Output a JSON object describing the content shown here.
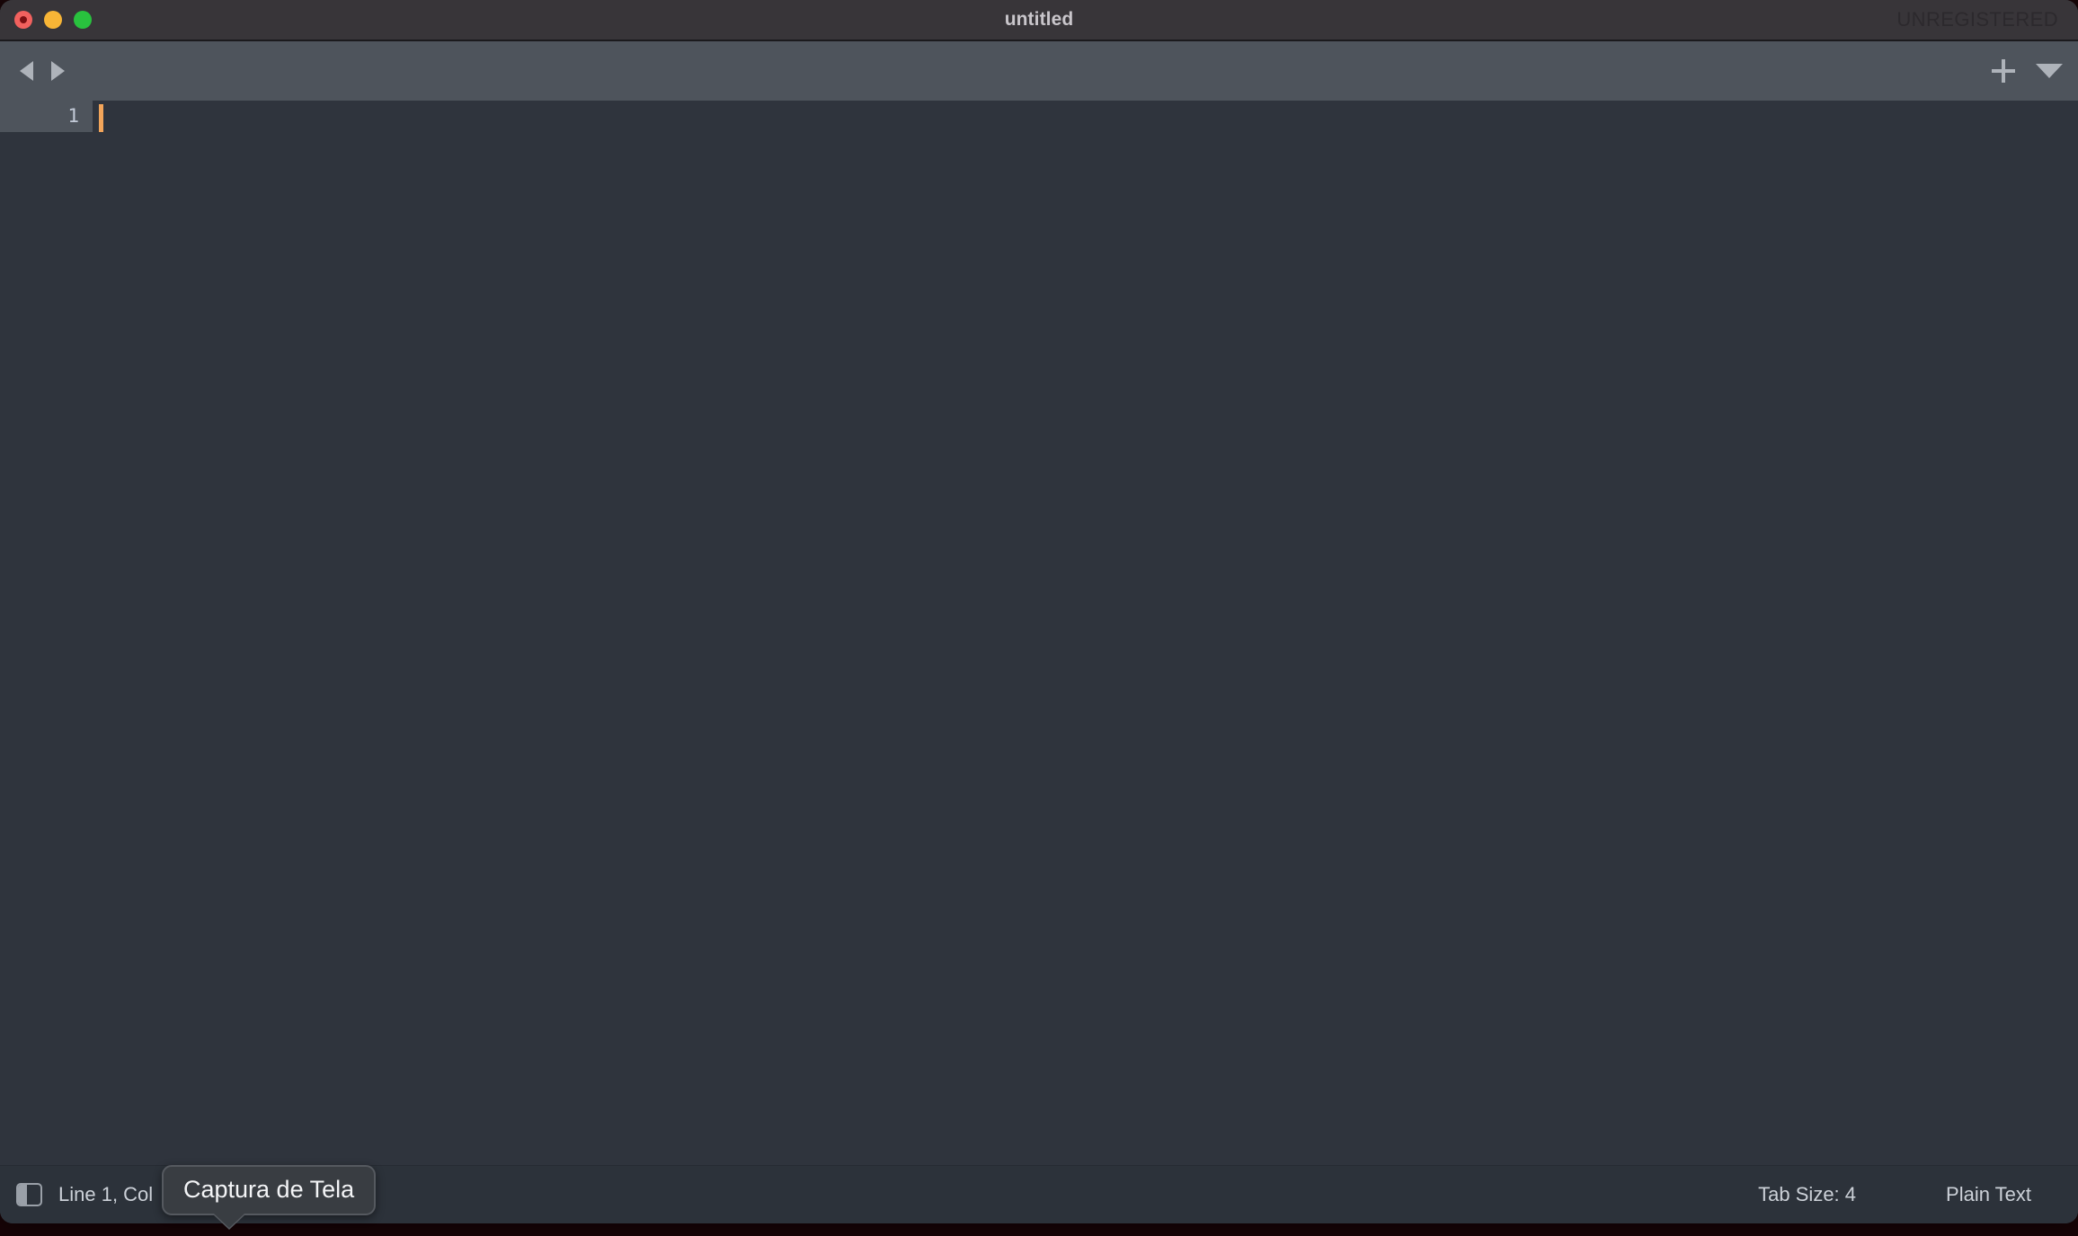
{
  "window": {
    "title": "untitled",
    "watermark": "UNREGISTERED",
    "traffic_lights": [
      {
        "name": "close",
        "color": "#f2615e"
      },
      {
        "name": "minimize",
        "color": "#f8b536"
      },
      {
        "name": "zoom",
        "color": "#29c23e"
      }
    ]
  },
  "toolbar": {
    "back_icon": "triangle-left-icon",
    "forward_icon": "triangle-right-icon",
    "add_icon": "plus-icon",
    "menu_icon": "chevron-down-icon"
  },
  "editor": {
    "lines": [
      {
        "number": "1",
        "text": "",
        "active": true
      }
    ],
    "caret_color": "#f3a55a"
  },
  "statusbar": {
    "sidebar_toggle_icon": "sidebar-toggle-icon",
    "cursor_position": "Line 1, Col",
    "tab_size": "Tab Size: 4",
    "syntax": "Plain Text"
  },
  "tooltip": {
    "text": "Captura de Tela"
  }
}
